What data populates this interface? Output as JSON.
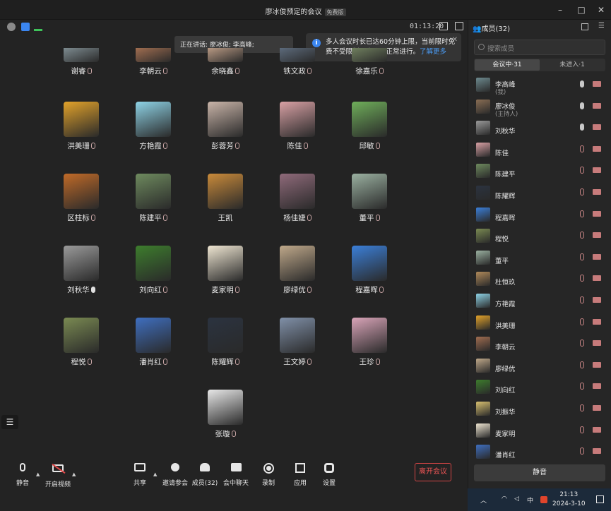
{
  "window": {
    "title": "廖冰俊预定的会议",
    "badge": "免费版",
    "timer": "01:13:20"
  },
  "speaking": {
    "label": "正在讲话: 廖冰俊; 李高峰;"
  },
  "notice": {
    "text": "多人会议时长已达60分钟上限，当前限时免费不受限制，会议可正常进行。",
    "link": "了解更多"
  },
  "grid": [
    {
      "name": "谢睿",
      "color": "#7d8b90"
    },
    {
      "name": "李朝云",
      "color": "#a06d50"
    },
    {
      "name": "余晓鑫",
      "color": "#b89983"
    },
    {
      "name": "铁文政",
      "color": "#5c6a7b"
    },
    {
      "name": "徐嘉乐",
      "color": "#6f7f5e"
    },
    {
      "name": "洪美珊",
      "color": "#e2a22a"
    },
    {
      "name": "方艳霞",
      "color": "#8ed3e6"
    },
    {
      "name": "彭蓉芳",
      "color": "#c9b4a8"
    },
    {
      "name": "陈佳",
      "color": "#d8a0a4"
    },
    {
      "name": "邱敏",
      "color": "#6fae5a"
    },
    {
      "name": "区柱标",
      "color": "#c06a28"
    },
    {
      "name": "陈建平",
      "color": "#6e8a5e"
    },
    {
      "name": "王凯",
      "color": "#c98a3a"
    },
    {
      "name": "杨佳婕",
      "color": "#8f6a7a"
    },
    {
      "name": "董平",
      "color": "#9ab0a0"
    },
    {
      "name": "刘秋华",
      "color": "#9a9a9a"
    },
    {
      "name": "刘向红",
      "color": "#3d7d2d"
    },
    {
      "name": "麦家明",
      "color": "#efe6d2"
    },
    {
      "name": "廖绿优",
      "color": "#bfa88a"
    },
    {
      "name": "程嘉晖",
      "color": "#3b7fd8"
    },
    {
      "name": "程悦",
      "color": "#7a8a52"
    },
    {
      "name": "潘肖红",
      "color": "#3f6fc0"
    },
    {
      "name": "陈耀辉",
      "color": "#2b3340"
    },
    {
      "name": "王文婷",
      "color": "#8090a8"
    },
    {
      "name": "王珍",
      "color": "#d9a4b8"
    },
    {
      "name": "张璇",
      "color": "#e8e8e8"
    }
  ],
  "toolbar": {
    "mute": "静音",
    "video": "开启视频",
    "share": "共享",
    "invite": "邀请参会",
    "members": "成员(32)",
    "chat": "会中聊天",
    "record": "录制",
    "apps": "应用",
    "settings": "设置",
    "leave": "离开会议"
  },
  "panel": {
    "title": "成员(32)",
    "search_placeholder": "搜索成员",
    "tab_in": "会议中·31",
    "tab_out": "未进入·1",
    "mute_all": "静音",
    "members": [
      {
        "name": "李高峰",
        "role": "(我)",
        "color": "#6d8a8f",
        "mic": "on"
      },
      {
        "name": "廖冰俊",
        "role": "(主持人)",
        "color": "#8a6e54",
        "mic": "on"
      },
      {
        "name": "刘秋华",
        "role": "",
        "color": "#9a9a9a",
        "mic": "on"
      },
      {
        "name": "陈佳",
        "role": "",
        "color": "#d8a0a4",
        "mic": "off"
      },
      {
        "name": "陈建平",
        "role": "",
        "color": "#6e8a5e",
        "mic": "off"
      },
      {
        "name": "陈耀辉",
        "role": "",
        "color": "#2b3340",
        "mic": "off"
      },
      {
        "name": "程嘉晖",
        "role": "",
        "color": "#3b7fd8",
        "mic": "off"
      },
      {
        "name": "程悦",
        "role": "",
        "color": "#7a8a52",
        "mic": "off"
      },
      {
        "name": "董平",
        "role": "",
        "color": "#9ab0a0",
        "mic": "off"
      },
      {
        "name": "杜恒玖",
        "role": "",
        "color": "#b08a5a",
        "mic": "off"
      },
      {
        "name": "方艳霞",
        "role": "",
        "color": "#8ed3e6",
        "mic": "off"
      },
      {
        "name": "洪美珊",
        "role": "",
        "color": "#e2a22a",
        "mic": "off"
      },
      {
        "name": "李朝云",
        "role": "",
        "color": "#a06d50",
        "mic": "off"
      },
      {
        "name": "廖绿优",
        "role": "",
        "color": "#bfa88a",
        "mic": "off"
      },
      {
        "name": "刘向红",
        "role": "",
        "color": "#3d7d2d",
        "mic": "off"
      },
      {
        "name": "刘振华",
        "role": "",
        "color": "#d8c070",
        "mic": "off"
      },
      {
        "name": "麦家明",
        "role": "",
        "color": "#efe6d2",
        "mic": "off"
      },
      {
        "name": "潘肖红",
        "role": "",
        "color": "#3f6fc0",
        "mic": "off"
      }
    ]
  },
  "taskbar": {
    "ime": "中",
    "time": "21:13",
    "date": "2024-3-10"
  },
  "colors": {
    "accent": "#3b86f0",
    "leave": "#d24545"
  }
}
